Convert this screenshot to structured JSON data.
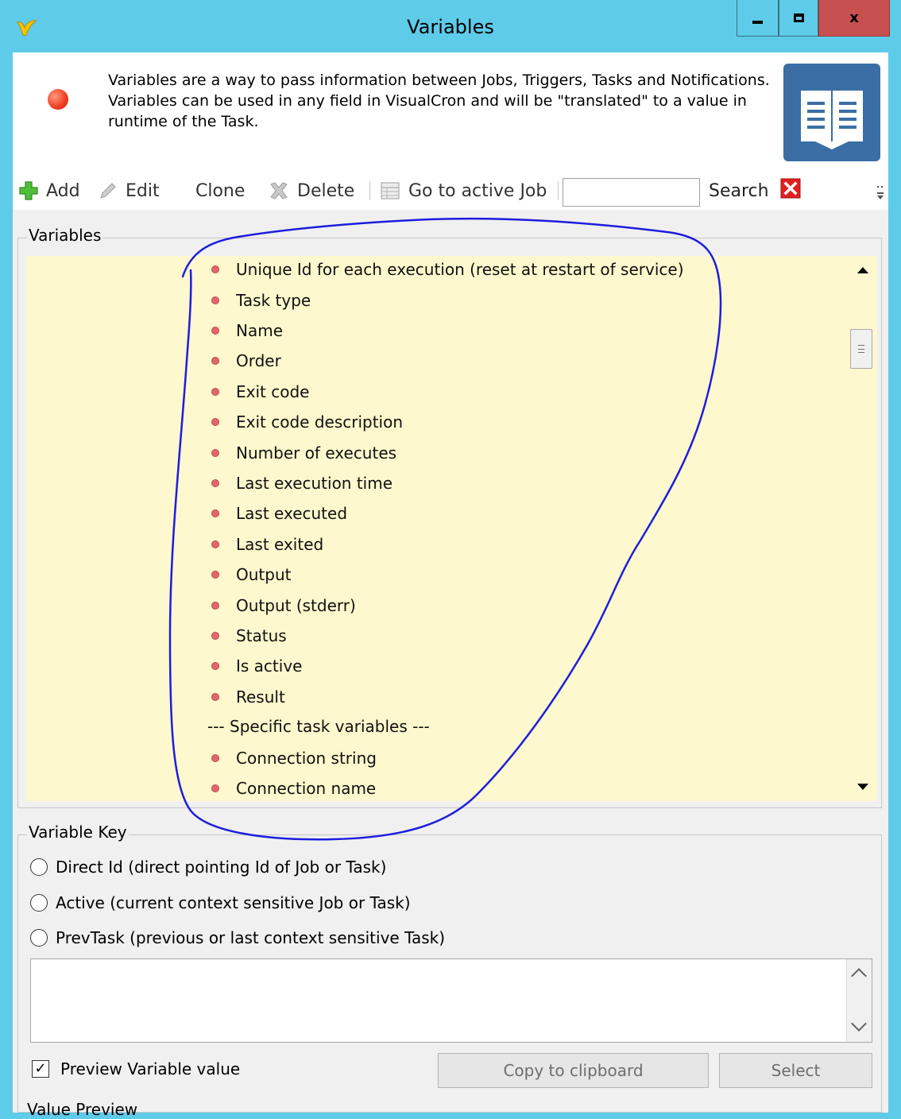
{
  "window": {
    "title": "Variables",
    "minimize_icon": "minimize-icon",
    "maximize_icon": "maximize-icon",
    "close_glyph": "x"
  },
  "header": {
    "description": "Variables are a way to pass information between Jobs, Triggers, Tasks and Notifications. Variables can be used in any field in VisualCron and will be \"translated\" to a value in runtime of the Task."
  },
  "toolbar": {
    "add": "Add",
    "edit": "Edit",
    "clone": "Clone",
    "delete": "Delete",
    "go_to_active_job": "Go to active Job",
    "search_value": "",
    "search_label": "Search"
  },
  "variables_group": {
    "label": "Variables",
    "items": [
      "Unique Id for each execution (reset at restart of service)",
      "Task type",
      "Name",
      "Order",
      "Exit code",
      "Exit code description",
      "Number of executes",
      "Last execution time",
      "Last executed",
      "Last exited",
      "Output",
      "Output (stderr)",
      "Status",
      "Is active",
      "Result"
    ],
    "section_header": "--- Specific task variables ---",
    "specific_items": [
      "Connection string",
      "Connection name"
    ]
  },
  "variable_key": {
    "label": "Variable Key",
    "options": [
      "Direct Id (direct pointing Id of Job or Task)",
      "Active (current context sensitive Job or Task)",
      "PrevTask (previous or last context sensitive Task)"
    ],
    "textarea_value": ""
  },
  "preview": {
    "checkbox_label": "Preview Variable value",
    "checked": true,
    "checkmark": "✓",
    "copy_button": "Copy to clipboard",
    "select_button": "Select",
    "value_preview_label": "Value Preview"
  },
  "colors": {
    "titlebar": "#5ecbe9",
    "list_background": "#fdf8cd",
    "bullet": "#e3666b",
    "annotation": "#1d1ddd"
  }
}
